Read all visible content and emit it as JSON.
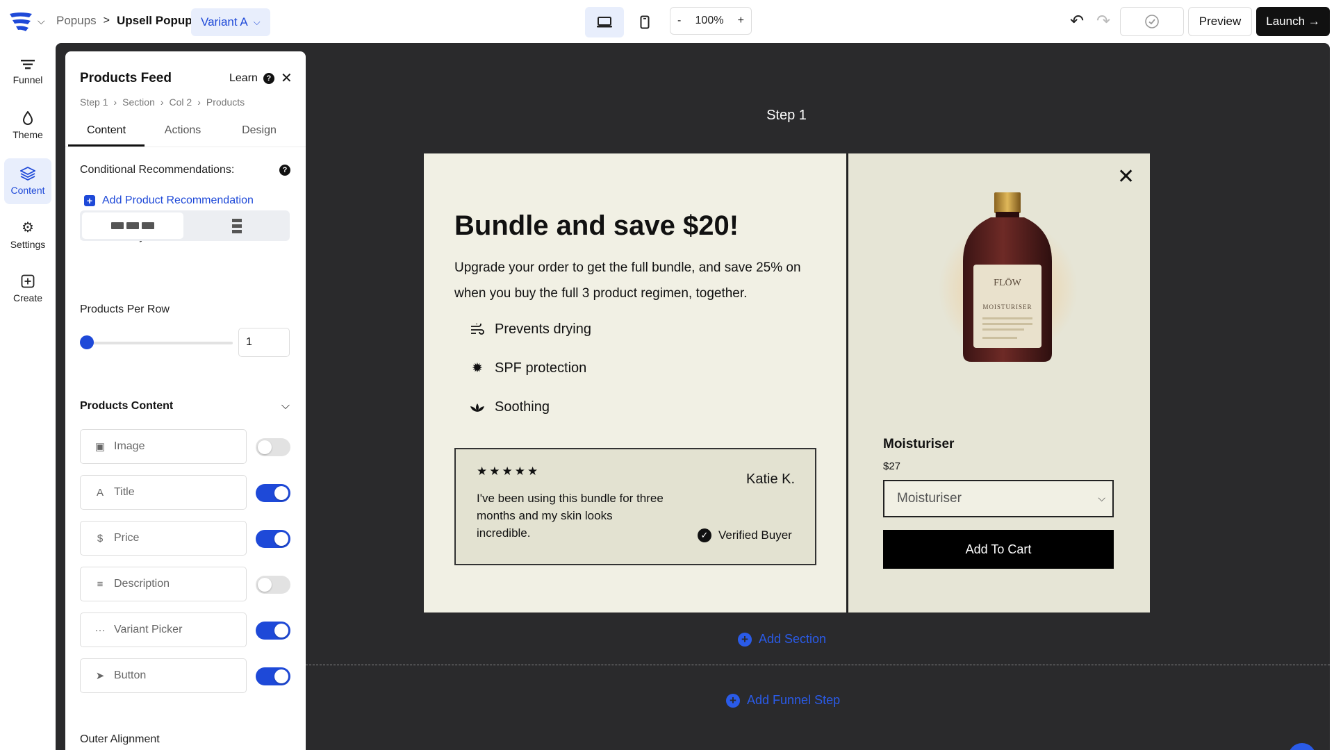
{
  "header": {
    "breadcrumb": [
      "Popups",
      "Upsell Popup"
    ],
    "breadcrumb_sep": ">",
    "variant": "Variant A",
    "zoom_minus": "-",
    "zoom_level": "100%",
    "zoom_plus": "+",
    "preview_label": "Preview",
    "launch_label": "Launch →"
  },
  "rail": {
    "items": [
      {
        "label": "Funnel",
        "icon": "funnel-icon"
      },
      {
        "label": "Theme",
        "icon": "droplet-icon"
      },
      {
        "label": "Content",
        "icon": "layers-icon"
      },
      {
        "label": "Settings",
        "icon": "gear-icon"
      },
      {
        "label": "Create",
        "icon": "plus-square-icon"
      }
    ],
    "active": "Content"
  },
  "panel": {
    "title": "Products Feed",
    "learn": "Learn",
    "breadcrumb": [
      "Step 1",
      "Section",
      "Col 2",
      "Products"
    ],
    "tabs": [
      "Content",
      "Actions",
      "Design"
    ],
    "active_tab": "Content",
    "conditional_label": "Conditional Recommendations:",
    "add_recommendation": "Add Product Recommendation",
    "layout_label": "Products Layout",
    "per_row_label": "Products Per Row",
    "per_row_value": "1",
    "content_label": "Products Content",
    "content_items": [
      {
        "label": "Image",
        "icon": "image-icon",
        "enabled": false
      },
      {
        "label": "Title",
        "icon": "text-icon",
        "enabled": true
      },
      {
        "label": "Price",
        "icon": "dollar-icon",
        "enabled": true
      },
      {
        "label": "Description",
        "icon": "align-left-icon",
        "enabled": false
      },
      {
        "label": "Variant Picker",
        "icon": "dots-icon",
        "enabled": true
      },
      {
        "label": "Button",
        "icon": "cursor-icon",
        "enabled": true
      }
    ],
    "outer_alignment_label": "Outer Alignment"
  },
  "canvas": {
    "step_label": "Step 1",
    "add_section": "Add Section",
    "add_funnel_step": "Add Funnel Step"
  },
  "popup": {
    "headline": "Bundle and save $20!",
    "subtext": "Upgrade your order to get the full bundle, and save 25% on when you buy the full 3 product regimen, together.",
    "benefits": [
      {
        "label": "Prevents drying",
        "icon": "wind-icon"
      },
      {
        "label": "SPF protection",
        "icon": "sun-icon"
      },
      {
        "label": "Soothing",
        "icon": "lotus-icon"
      }
    ],
    "review": {
      "stars": "★★★★★",
      "text": "I've been using this bundle for three months and my skin looks incredible.",
      "author": "Katie K.",
      "badge": "Verified Buyer"
    },
    "product": {
      "brand": "FLŌW",
      "label_name": "MOISTURISER",
      "title": "Moisturiser",
      "price": "$27",
      "variant": "Moisturiser",
      "cta": "Add To Cart"
    }
  },
  "colors": {
    "accent": "#1e49d8",
    "canvas_bg": "#2a2a2c",
    "popup_bg": "#f1f0e4"
  }
}
